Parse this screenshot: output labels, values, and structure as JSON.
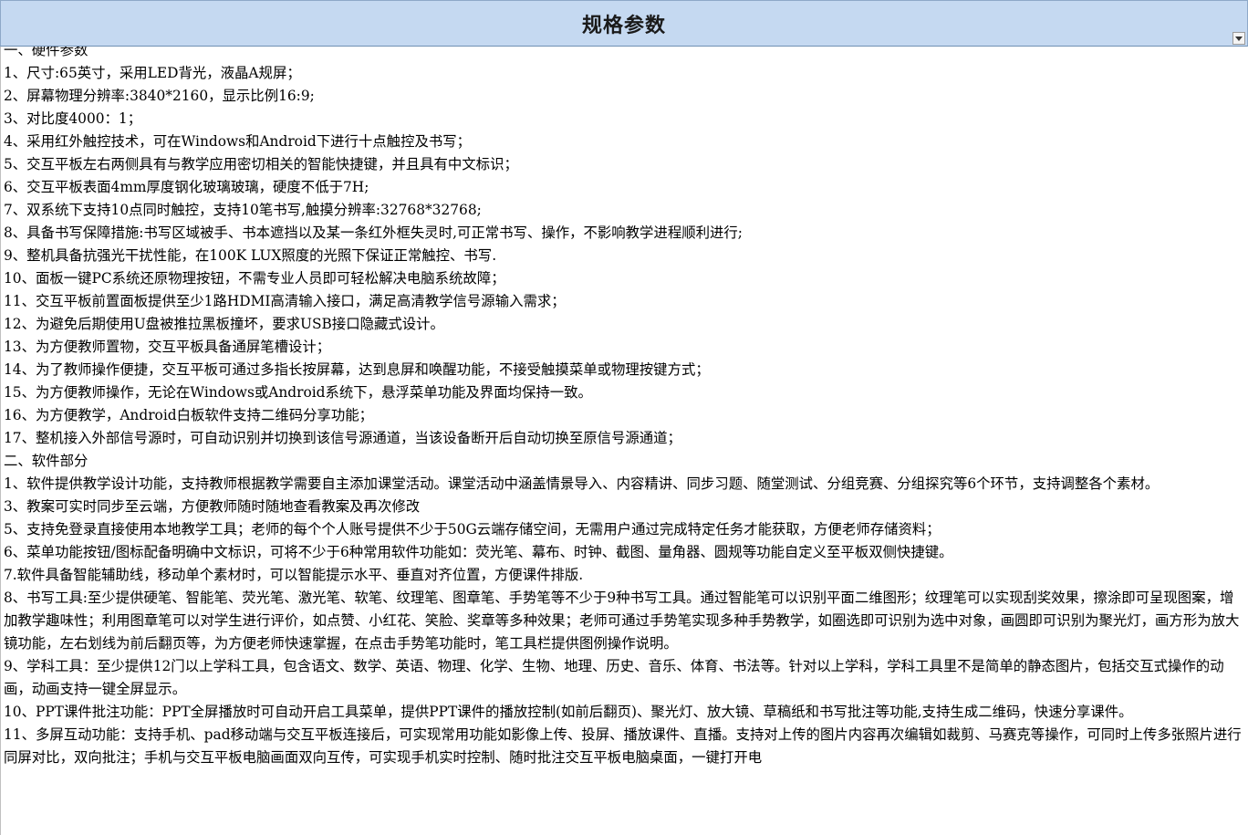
{
  "header": {
    "title": "规格参数"
  },
  "icons": {
    "dropdown": "chevron-down-icon"
  },
  "lines": [
    "一、硬件参数",
    "1、尺寸:65英寸，采用LED背光，液晶A规屏；",
    "2、屏幕物理分辨率:3840*2160，显示比例16:9;",
    "3、对比度4000：1；",
    "4、采用红外触控技术，可在Windows和Android下进行十点触控及书写；",
    "5、交互平板左右两侧具有与教学应用密切相关的智能快捷键，并且具有中文标识；",
    "6、交互平板表面4mm厚度钢化玻璃玻璃，硬度不低于7H;",
    "7、双系统下支持10点同时触控，支持10笔书写,触摸分辨率:32768*32768;",
    "8、具备书写保障措施:书写区域被手、书本遮挡以及某一条红外框失灵时,可正常书写、操作，不影响教学进程顺利进行;",
    "9、整机具备抗强光干扰性能，在100K LUX照度的光照下保证正常触控、书写.",
    "10、面板一键PC系统还原物理按钮，不需专业人员即可轻松解决电脑系统故障；",
    "11、交互平板前置面板提供至少1路HDMI高清输入接口，满足高清教学信号源输入需求；",
    "12、为避免后期使用U盘被推拉黑板撞坏，要求USB接口隐藏式设计。",
    "13、为方便教师置物，交互平板具备通屏笔槽设计；",
    "14、为了教师操作便捷，交互平板可通过多指长按屏幕，达到息屏和唤醒功能，不接受触摸菜单或物理按键方式；",
    "15、为方便教师操作，无论在Windows或Android系统下，悬浮菜单功能及界面均保持一致。",
    "16、为方便教学，Android白板软件支持二维码分享功能；",
    "17、整机接入外部信号源时，可自动识别并切换到该信号源通道，当该设备断开后自动切换至原信号源通道；",
    "二、软件部分",
    "1、软件提供教学设计功能，支持教师根据教学需要自主添加课堂活动。课堂活动中涵盖情景导入、内容精讲、同步习题、随堂测试、分组竞赛、分组探究等6个环节，支持调整各个素材。",
    "3、教案可实时同步至云端，方便教师随时随地查看教案及再次修改",
    "5、支持免登录直接使用本地教学工具；老师的每个个人账号提供不少于50G云端存储空间，无需用户通过完成特定任务才能获取，方便老师存储资料；",
    "6、菜单功能按钮/图标配备明确中文标识，可将不少于6种常用软件功能如：荧光笔、幕布、时钟、截图、量角器、圆规等功能自定义至平板双侧快捷键。",
    "7.软件具备智能辅助线，移动单个素材时，可以智能提示水平、垂直对齐位置，方便课件排版.",
    "8、书写工具:至少提供硬笔、智能笔、荧光笔、激光笔、软笔、纹理笔、图章笔、手势笔等不少于9种书写工具。通过智能笔可以识别平面二维图形；纹理笔可以实现刮奖效果，擦涂即可呈现图案，增加教学趣味性；利用图章笔可以对学生进行评价，如点赞、小红花、笑脸、奖章等多种效果；老师可通过手势笔实现多种手势教学，如圈选即可识别为选中对象，画圆即可识别为聚光灯，画方形为放大镜功能，左右划线为前后翻页等，为方便老师快速掌握，在点击手势笔功能时，笔工具栏提供图例操作说明。",
    "9、学科工具：至少提供12门以上学科工具，包含语文、数学、英语、物理、化学、生物、地理、历史、音乐、体育、书法等。针对以上学科，学科工具里不是简单的静态图片，包括交互式操作的动画，动画支持一键全屏显示。",
    "10、PPT课件批注功能：PPT全屏播放时可自动开启工具菜单，提供PPT课件的播放控制(如前后翻页)、聚光灯、放大镜、草稿纸和书写批注等功能,支持生成二维码，快速分享课件。",
    "11、多屏互动功能：支持手机、pad移动端与交互平板连接后，可实现常用功能如影像上传、投屏、播放课件、直播。支持对上传的图片内容再次编辑如裁剪、马赛克等操作，可同时上传多张照片进行同屏对比，双向批注；手机与交互平板电脑画面双向互传，可实现手机实时控制、随时批注交互平板电脑桌面，一键打开电"
  ]
}
